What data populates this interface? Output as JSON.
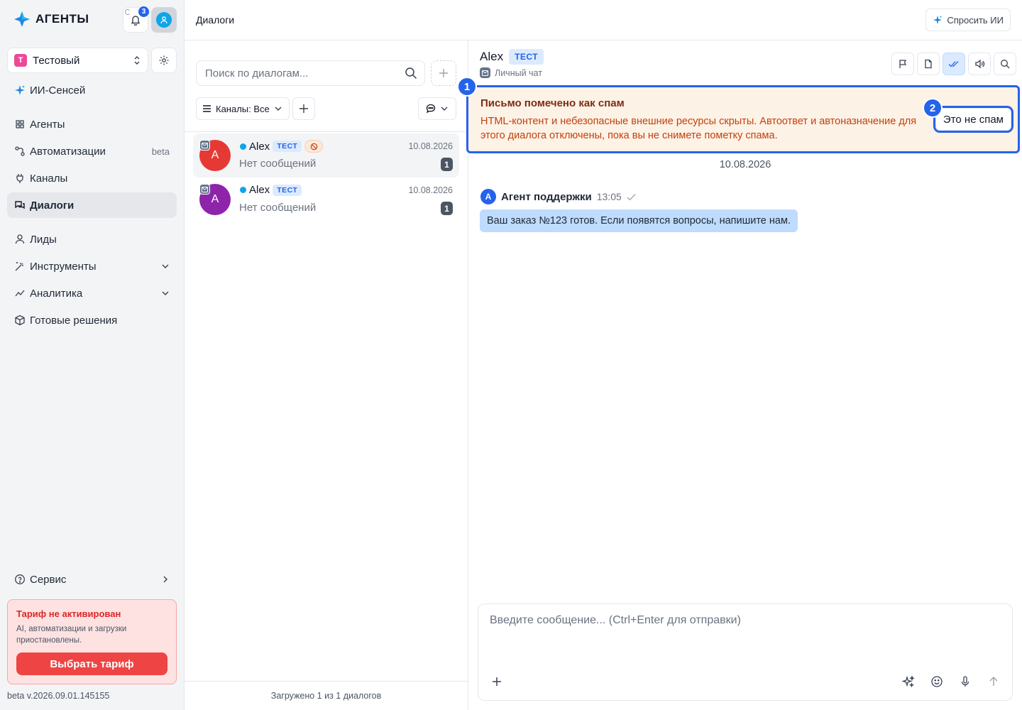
{
  "app": {
    "name": "АГЕНТЫ",
    "notifications_count": "3"
  },
  "workspace": {
    "avatar_letter": "Т",
    "name": "Тестовый"
  },
  "nav": {
    "ai_sensei": "ИИ-Сенсей",
    "agents": "Агенты",
    "automations": "Автоматизации",
    "automations_badge": "beta",
    "channels": "Каналы",
    "dialogs": "Диалоги",
    "leads": "Лиды",
    "tools": "Инструменты",
    "analytics": "Аналитика",
    "solutions": "Готовые решения",
    "service": "Сервис"
  },
  "tariff": {
    "title": "Тариф не активирован",
    "text": "AI, автоматизации и загрузки приостановлены.",
    "button": "Выбрать тариф"
  },
  "version": "beta v.2026.09.01.145155",
  "header": {
    "title": "Диалоги",
    "ask_ai": "Спросить ИИ"
  },
  "list": {
    "search_placeholder": "Поиск по диалогам...",
    "channels_filter": "Каналы: Все",
    "footer": "Загружено 1 из 1 диалогов",
    "dialogs": [
      {
        "avatar": "A",
        "avatar_color": "#e53935",
        "name": "Alex",
        "tag": "ТЕСТ",
        "date": "10.08.2026",
        "last_message": "Нет сообщений",
        "unread": "1",
        "spam": true,
        "selected": true
      },
      {
        "avatar": "A",
        "avatar_color": "#8e24aa",
        "name": "Alex",
        "tag": "ТЕСТ",
        "date": "10.08.2026",
        "last_message": "Нет сообщений",
        "unread": "1",
        "spam": false,
        "selected": false
      }
    ]
  },
  "chat": {
    "name": "Alex",
    "tag": "ТЕСТ",
    "subtitle": "Личный чат",
    "spam_banner": {
      "title": "Письмо помечено как спам",
      "text": "HTML-контент и небезопасные внешние ресурсы скрыты. Автоответ и автоназначение для этого диалога отключены, пока вы не снимете пометку спама.",
      "button": "Это не спам",
      "marker_1": "1",
      "marker_2": "2"
    },
    "date_separator": "10.08.2026",
    "messages": [
      {
        "avatar": "A",
        "author": "Агент поддержки",
        "time": "13:05",
        "text": "Ваш заказ №123 готов. Если появятся вопросы, напишите нам."
      }
    ],
    "composer_placeholder": "Введите сообщение... (Ctrl+Enter для отправки)"
  },
  "colors": {
    "accent": "#2563eb",
    "spam_bg": "#fdf2e6",
    "spam_text": "#c2410c",
    "tariff_red": "#ef4444"
  }
}
